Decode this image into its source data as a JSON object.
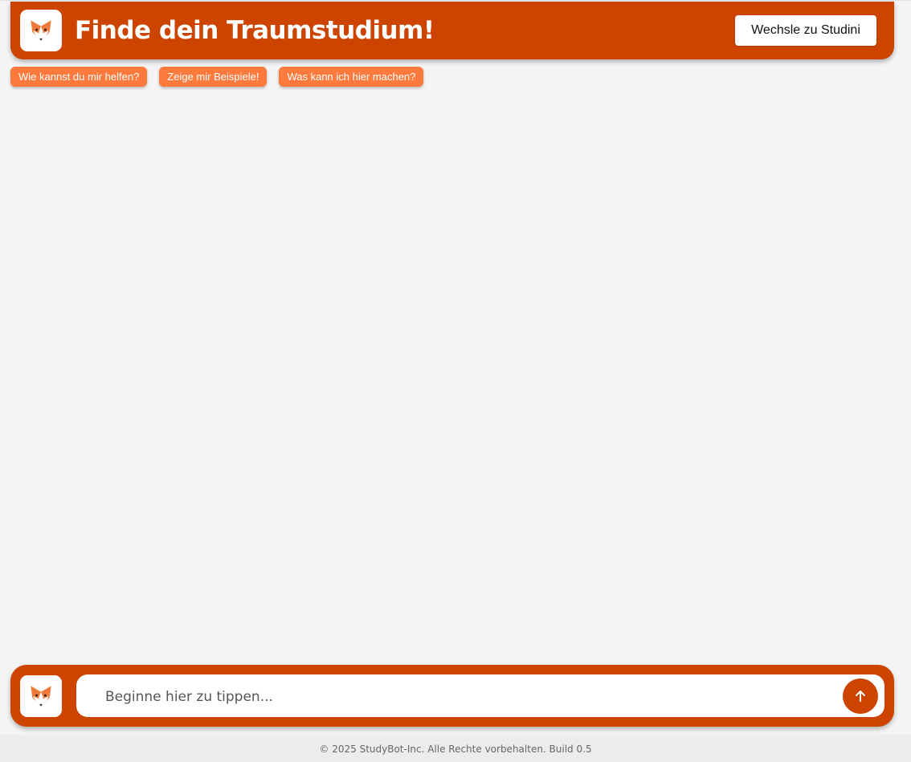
{
  "header": {
    "title": "Finde dein Traumstudium!",
    "switch_button": "Wechsle zu Studini",
    "logo_icon": "fox-icon"
  },
  "suggestions": [
    {
      "label": "Wie kannst du mir helfen?"
    },
    {
      "label": "Zeige mir Beispiele!"
    },
    {
      "label": "Was kann ich hier machen?"
    }
  ],
  "composer": {
    "avatar_icon": "fox-icon",
    "placeholder": "Beginne hier zu tippen...",
    "value": "",
    "send_icon": "arrow-up-icon"
  },
  "footer": {
    "text": "© 2025 StudyBot-Inc. Alle Rechte vorbehalten. Build 0.5"
  },
  "colors": {
    "brand": "#cc4400",
    "chip": "#ff7a3c",
    "background": "#f4f4f4"
  }
}
